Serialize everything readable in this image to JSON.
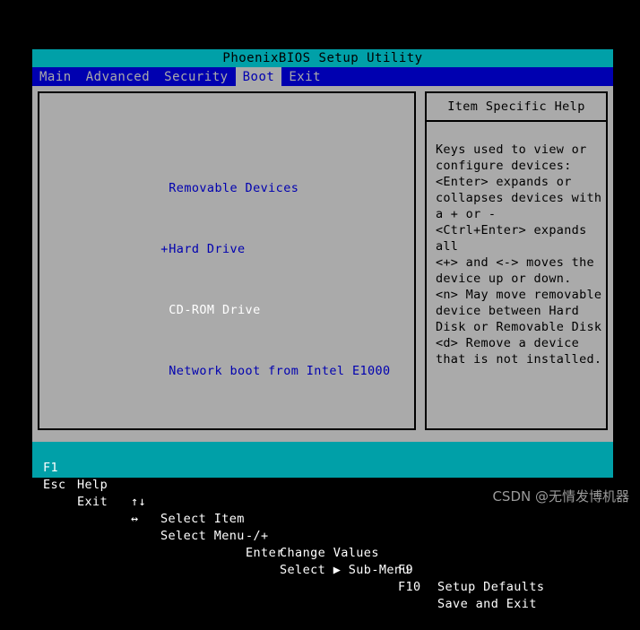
{
  "colors": {
    "screen_bg": "#aaaaaa",
    "title_bar": "#00a0a8",
    "menu_bar": "#0000b0",
    "menu_text": "#aaaaaa",
    "active_tab_bg": "#aaaaaa",
    "active_tab_text": "#0000b0",
    "device_text": "#0000b0",
    "selected_device_text": "#ffffff",
    "help_text": "#000000",
    "key_bar_bg": "#00a0a8",
    "key_bar_text": "#ffffff",
    "outer_bg": "#000000",
    "watermark": "#9a9a9a"
  },
  "title": "PhoenixBIOS Setup Utility",
  "menu": {
    "tabs": [
      {
        "label": "Main",
        "active": false
      },
      {
        "label": "Advanced",
        "active": false
      },
      {
        "label": "Security",
        "active": false
      },
      {
        "label": "Boot",
        "active": true
      },
      {
        "label": "Exit",
        "active": false
      }
    ]
  },
  "boot_order": {
    "devices": [
      {
        "marker": " ",
        "label": "Removable Devices",
        "selected": false
      },
      {
        "marker": "+",
        "label": "Hard Drive",
        "selected": false
      },
      {
        "marker": " ",
        "label": "CD-ROM Drive",
        "selected": true
      },
      {
        "marker": " ",
        "label": "Network boot from Intel E1000",
        "selected": false
      }
    ]
  },
  "help": {
    "header": "Item Specific Help",
    "lines": [
      "Keys used to view or",
      "configure devices:",
      "<Enter> expands or",
      "collapses devices with",
      "a + or -",
      "<Ctrl+Enter> expands",
      "all",
      "<+> and <-> moves the",
      "device up or down.",
      "<n> May move removable",
      "device between Hard",
      "Disk or Removable Disk",
      "<d> Remove a device",
      "that is not installed."
    ]
  },
  "key_bar": {
    "row1": [
      {
        "key": "F1",
        "desc": "Help"
      },
      {
        "key": "↑↓",
        "desc": "Select Item"
      },
      {
        "key": "-/+",
        "desc": "Change Values"
      },
      {
        "key": "F9",
        "desc": "Setup Defaults"
      }
    ],
    "row2": [
      {
        "key": "Esc",
        "desc": "Exit"
      },
      {
        "key": "↔",
        "desc": "Select Menu"
      },
      {
        "key": "Enter",
        "desc": "Select ▶ Sub-Menu"
      },
      {
        "key": "F10",
        "desc": "Save and Exit"
      }
    ]
  },
  "watermark": "CSDN @无情发博机器"
}
